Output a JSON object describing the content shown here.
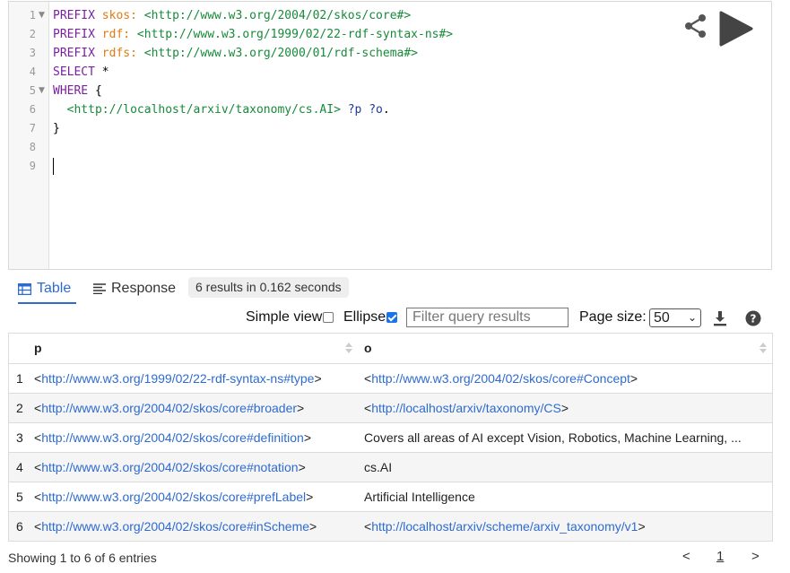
{
  "editor": {
    "line_numbers": [
      "1",
      "2",
      "3",
      "4",
      "5",
      "6",
      "7",
      "8",
      "9"
    ],
    "lines": [
      {
        "kw": "PREFIX ",
        "pre": "skos:",
        "iri": " <http://www.w3.org/2004/02/skos/core#>"
      },
      {
        "kw": "PREFIX ",
        "pre": "rdf:",
        "iri": " <http://www.w3.org/1999/02/22-rdf-syntax-ns#>"
      },
      {
        "kw": "PREFIX ",
        "pre": "rdfs:",
        "iri": " <http://www.w3.org/2000/01/rdf-schema#>"
      },
      {
        "kw": "SELECT",
        "plain": " *"
      },
      {
        "kw": "WHERE",
        "plain": " {"
      },
      {
        "iri": "  <http://localhost/arxiv/taxonomy/cs.AI>",
        "var": " ?p ?o",
        "plain": "."
      },
      {
        "plain": "}"
      }
    ]
  },
  "tabs": {
    "table": "Table",
    "response": "Response"
  },
  "results_info": "6 results in 0.162 seconds",
  "controls": {
    "simple_view": "Simple view",
    "ellipse": "Ellipse",
    "filter_placeholder": "Filter query results",
    "page_size_label": "Page size:",
    "page_size_value": "50"
  },
  "table": {
    "columns": [
      "p",
      "o"
    ],
    "rows": [
      {
        "n": "1",
        "p": {
          "pre": "<",
          "link": "http://www.w3.org/1999/02/22-rdf-syntax-ns#type",
          "post": ">"
        },
        "o": {
          "pre": "<",
          "link": "http://www.w3.org/2004/02/skos/core#Concept",
          "post": ">"
        }
      },
      {
        "n": "2",
        "p": {
          "pre": "<",
          "link": "http://www.w3.org/2004/02/skos/core#broader",
          "post": ">"
        },
        "o": {
          "pre": "<",
          "link": "http://localhost/arxiv/taxonomy/CS",
          "post": ">"
        }
      },
      {
        "n": "3",
        "p": {
          "pre": "<",
          "link": "http://www.w3.org/2004/02/skos/core#definition",
          "post": ">"
        },
        "o": {
          "text": "Covers all areas of AI except Vision, Robotics, Machine Learning, ..."
        }
      },
      {
        "n": "4",
        "p": {
          "pre": "<",
          "link": "http://www.w3.org/2004/02/skos/core#notation",
          "post": ">"
        },
        "o": {
          "text": "cs.AI"
        }
      },
      {
        "n": "5",
        "p": {
          "pre": "<",
          "link": "http://www.w3.org/2004/02/skos/core#prefLabel",
          "post": ">"
        },
        "o": {
          "text": "Artificial Intelligence"
        }
      },
      {
        "n": "6",
        "p": {
          "pre": "<",
          "link": "http://www.w3.org/2004/02/skos/core#inScheme",
          "post": ">"
        },
        "o": {
          "pre": "<",
          "link": "http://localhost/arxiv/scheme/arxiv_taxonomy/v1",
          "post": ">"
        }
      }
    ]
  },
  "footer": {
    "entries": "Showing 1 to 6 of 6 entries",
    "prev": "<",
    "page": "1",
    "next": ">"
  },
  "icons": {
    "share": "share-icon",
    "run": "play-icon",
    "download": "download-icon",
    "help": "help-icon",
    "table": "table-icon",
    "response": "lines-icon"
  }
}
